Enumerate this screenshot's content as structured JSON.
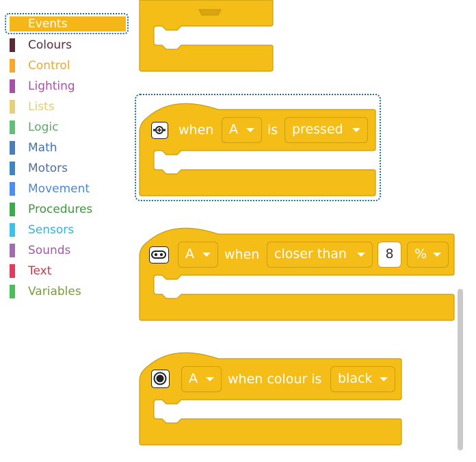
{
  "categories": [
    {
      "label": "Events",
      "color": "#f5b717",
      "selected": true
    },
    {
      "label": "Colours",
      "color": "#5a2a36"
    },
    {
      "label": "Control",
      "color": "#f9a828"
    },
    {
      "label": "Lighting",
      "color": "#a552a8"
    },
    {
      "label": "Lists",
      "color": "#e8d07a"
    },
    {
      "label": "Logic",
      "color": "#62bf7a"
    },
    {
      "label": "Math",
      "color": "#4a7fbf"
    },
    {
      "label": "Motors",
      "color": "#3f86c6"
    },
    {
      "label": "Movement",
      "color": "#4b8ef5"
    },
    {
      "label": "Procedures",
      "color": "#3daa4b"
    },
    {
      "label": "Sensors",
      "color": "#39c3e8"
    },
    {
      "label": "Sounds",
      "color": "#a56bb0"
    },
    {
      "label": "Text",
      "color": "#e03c5c"
    },
    {
      "label": "Variables",
      "color": "#4cbf5a"
    }
  ],
  "category_text_colors": [
    "#ffffff",
    "#5a2a36",
    "#f2a733",
    "#a552a8",
    "#e3cb7e",
    "#5fa86c",
    "#3f72b0",
    "#4f6e9e",
    "#4a86d9",
    "#3b9a3a",
    "#3bb0d6",
    "#9b5ca8",
    "#c33a4a",
    "#7a9a3a"
  ],
  "colors": {
    "block": "#f5bd17",
    "block_border": "#c79d09",
    "selection": "#1c6f8a"
  },
  "blocks": {
    "button": {
      "icon": "button-sensor-icon",
      "word1": "when",
      "port": "A",
      "word2": "is",
      "state": "pressed"
    },
    "distance": {
      "icon": "distance-sensor-icon",
      "port": "A",
      "word1": "when",
      "comparison": "closer than",
      "value": "8",
      "unit": "%"
    },
    "colour": {
      "icon": "color-sensor-icon",
      "port": "A",
      "word1": "when colour is",
      "colour": "black"
    }
  }
}
